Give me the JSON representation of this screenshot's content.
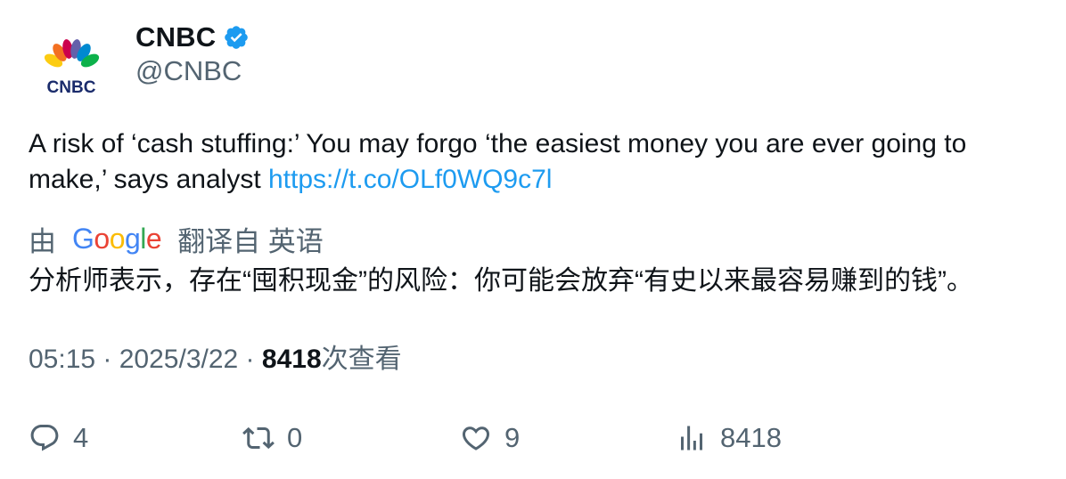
{
  "author": {
    "display_name": "CNBC",
    "handle": "@CNBC",
    "avatar_logo_text": "CNBC",
    "verified": true,
    "verified_color": "#1d9bf0"
  },
  "tweet": {
    "text": "A risk of ‘cash stuffing:’ You may forgo ‘the easiest money you are ever going to make,’ says analyst ",
    "link": "https://t.co/OLf0WQ9c7l",
    "link_color": "#1d9bf0"
  },
  "translation": {
    "by_label": "由",
    "provider": "Google",
    "from_label": "翻译自 英语",
    "text": "分析师表示，存在“囤积现金”的风险：你可能会放弃“有史以来最容易赚到的钱”。"
  },
  "meta": {
    "time": "05:15",
    "date": "2025/3/22",
    "separator": " · ",
    "views": "8418",
    "views_label": "次查看"
  },
  "actions": {
    "reply": {
      "icon": "reply-icon",
      "count": "4"
    },
    "retweet": {
      "icon": "retweet-icon",
      "count": "0"
    },
    "like": {
      "icon": "heart-icon",
      "count": "9"
    },
    "views": {
      "icon": "views-chart-icon",
      "count": "8418"
    }
  },
  "colors": {
    "text_primary": "#0f1419",
    "text_secondary": "#536471",
    "accent": "#1d9bf0"
  }
}
